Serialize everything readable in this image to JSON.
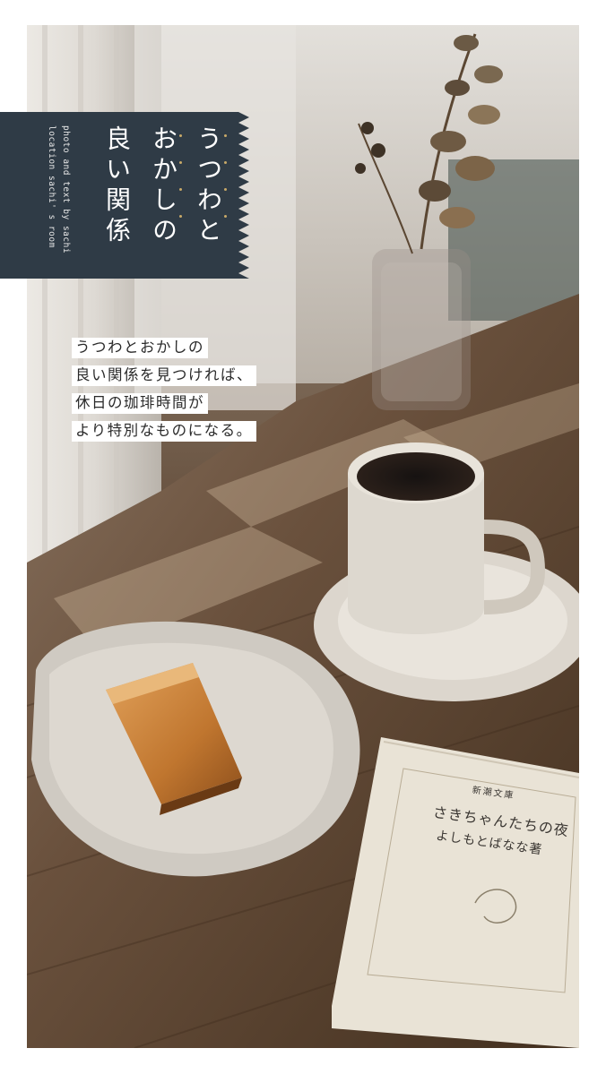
{
  "title": {
    "lines": [
      "うつわと",
      "おかしの",
      "良い関係"
    ]
  },
  "credits": {
    "line1": "photo and text by sachi",
    "line2": "location sachi' s room"
  },
  "body": {
    "lines": [
      "うつわとおかしの",
      "良い関係を見つければ、",
      "休日の珈琲時間が",
      "より特別なものになる。"
    ]
  },
  "book": {
    "publisher": "新潮文庫",
    "title": "さきちゃんたちの夜",
    "author": "よしもとばなな著"
  },
  "colors": {
    "banner": "#2f3b46",
    "dot_accent": "#c9a968",
    "table_wood": "#5d4634"
  }
}
